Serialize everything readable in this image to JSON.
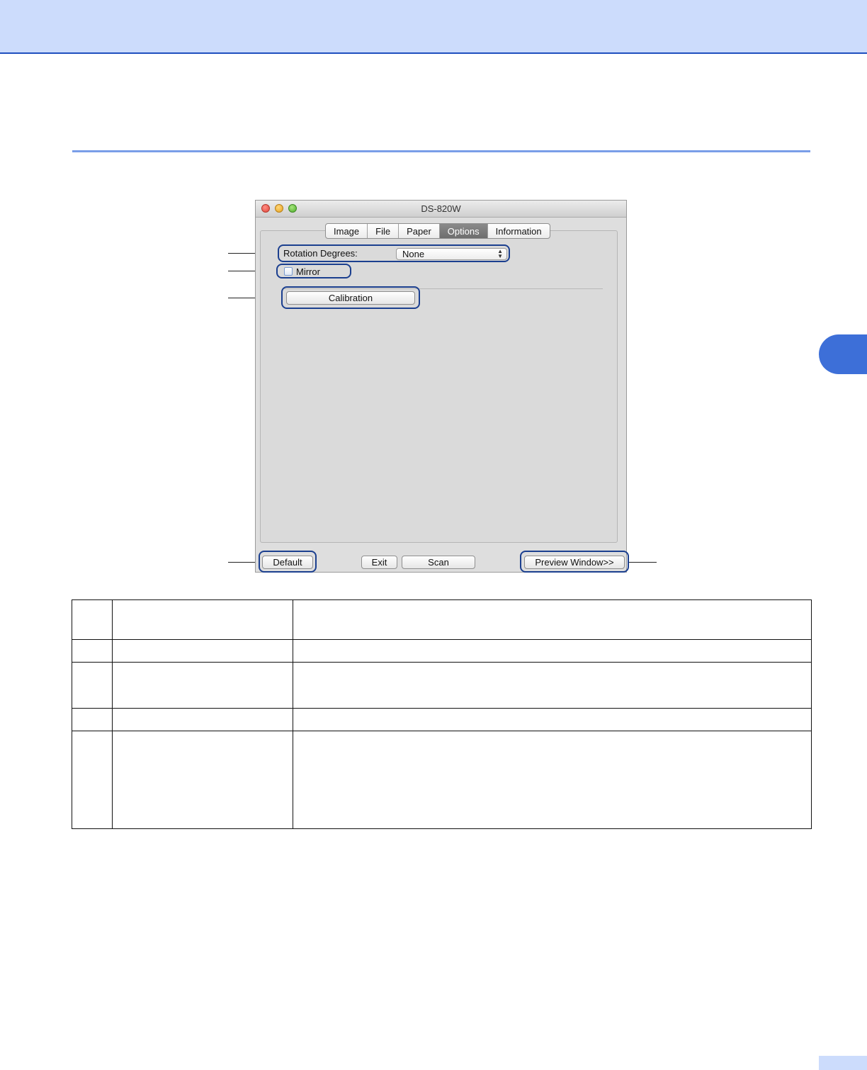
{
  "window": {
    "title": "DS-820W",
    "tabs": [
      "Image",
      "File",
      "Paper",
      "Options",
      "Information"
    ],
    "active_tab": "Options"
  },
  "options": {
    "rotation_label": "Rotation Degrees:",
    "rotation_value": "None",
    "mirror_label": "Mirror",
    "mirror_checked": false,
    "calibration_label": "Calibration"
  },
  "footer": {
    "default_label": "Default",
    "exit_label": "Exit",
    "scan_label": "Scan",
    "preview_label": "Preview Window>>"
  },
  "colors": {
    "header_band": "#ccdcfc",
    "accent_blue": "#3d6fd8",
    "callout_border": "#1b3f8f"
  },
  "table": {
    "rows": 5
  }
}
